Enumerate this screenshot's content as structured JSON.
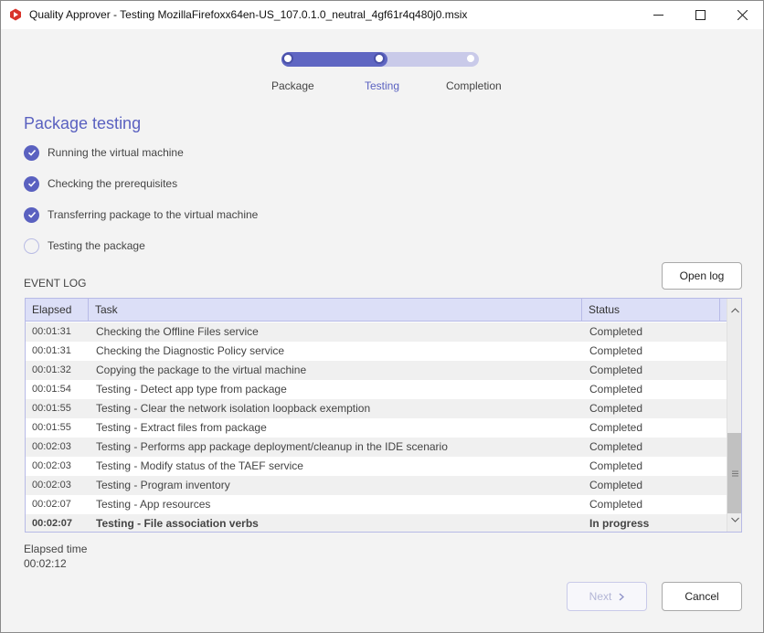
{
  "window": {
    "title": "Quality Approver - Testing MozillaFirefoxx64en-US_107.0.1.0_neutral_4gf61r4q480j0.msix",
    "controls": [
      "minimize",
      "maximize",
      "close"
    ]
  },
  "stepper": {
    "steps": [
      {
        "label": "Package",
        "state": "done"
      },
      {
        "label": "Testing",
        "state": "active"
      },
      {
        "label": "Completion",
        "state": "pending"
      }
    ],
    "accent": "#5f66c2"
  },
  "section": {
    "title": "Package testing",
    "checklist": [
      {
        "label": "Running the virtual machine",
        "done": true
      },
      {
        "label": "Checking the prerequisites",
        "done": true
      },
      {
        "label": "Transferring package to the virtual machine",
        "done": true
      },
      {
        "label": "Testing the package",
        "done": false
      }
    ]
  },
  "event_log": {
    "label": "EVENT LOG",
    "open_log_button": "Open log",
    "columns": [
      "Elapsed",
      "Task",
      "Status"
    ],
    "rows": [
      {
        "elapsed": "00:01:31",
        "task": "Checking the Offline Files service",
        "status": "Completed"
      },
      {
        "elapsed": "00:01:31",
        "task": "Checking the Diagnostic Policy service",
        "status": "Completed"
      },
      {
        "elapsed": "00:01:32",
        "task": "Copying the package to the virtual machine",
        "status": "Completed"
      },
      {
        "elapsed": "00:01:54",
        "task": "Testing - Detect app type from package",
        "status": "Completed"
      },
      {
        "elapsed": "00:01:55",
        "task": "Testing - Clear the network isolation loopback exemption",
        "status": "Completed"
      },
      {
        "elapsed": "00:01:55",
        "task": "Testing - Extract files from package",
        "status": "Completed"
      },
      {
        "elapsed": "00:02:03",
        "task": "Testing - Performs app package deployment/cleanup in the IDE scenario",
        "status": "Completed"
      },
      {
        "elapsed": "00:02:03",
        "task": "Testing - Modify status of the TAEF service",
        "status": "Completed"
      },
      {
        "elapsed": "00:02:03",
        "task": "Testing - Program inventory",
        "status": "Completed"
      },
      {
        "elapsed": "00:02:07",
        "task": "Testing - App resources",
        "status": "Completed"
      },
      {
        "elapsed": "00:02:07",
        "task": "Testing - File association verbs",
        "status": "In progress"
      }
    ]
  },
  "elapsed": {
    "label": "Elapsed time",
    "value": "00:02:12"
  },
  "footer": {
    "next_label": "Next",
    "cancel_label": "Cancel"
  }
}
